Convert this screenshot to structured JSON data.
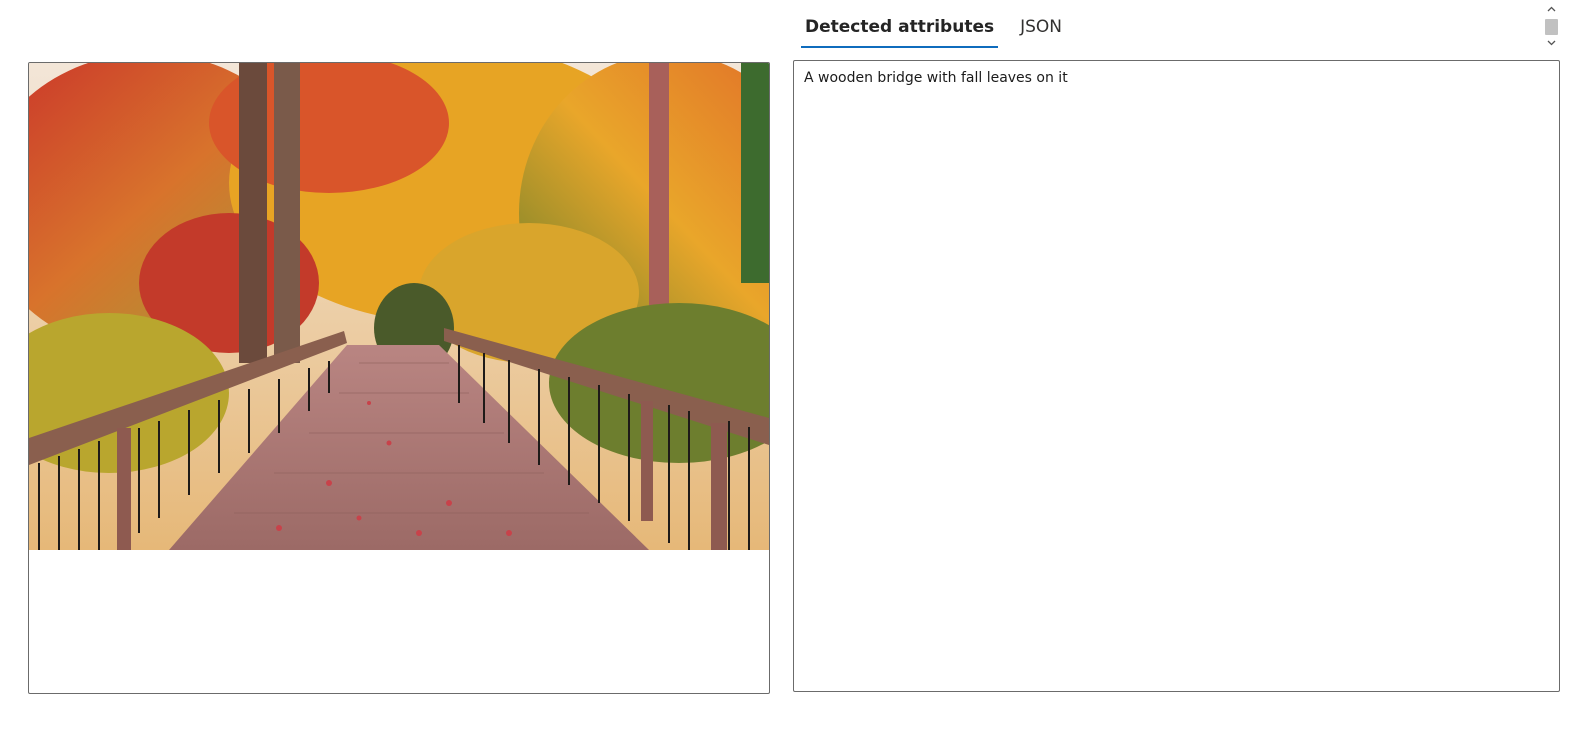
{
  "tabs": [
    {
      "label": "Detected attributes",
      "active": true
    },
    {
      "label": "JSON",
      "active": false
    }
  ],
  "results": {
    "caption": "A wooden bridge with fall leaves on it"
  },
  "image_panel": {
    "image": "autumn-wooden-bridge-photo"
  },
  "scrollbar": {
    "up_icon": "chevron-up-icon",
    "down_icon": "chevron-down-icon"
  },
  "colors": {
    "accent": "#0f6cbd",
    "border": "#6b6b6b"
  }
}
